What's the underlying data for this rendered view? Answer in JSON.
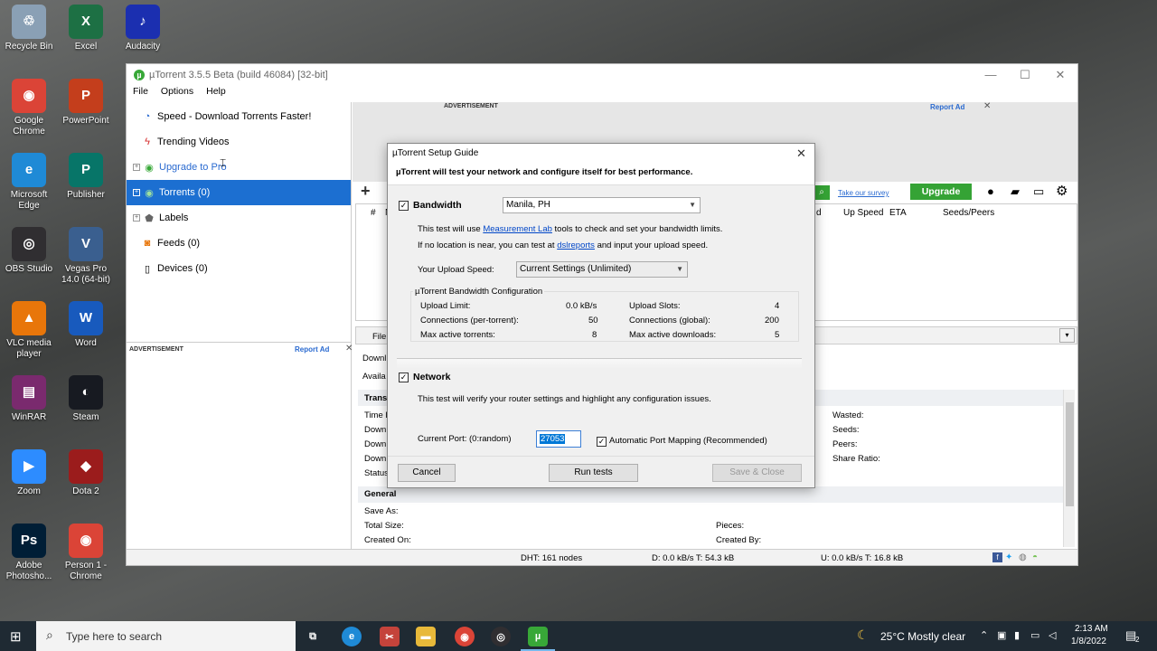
{
  "desktop": {
    "icons": [
      {
        "label": "Recycle Bin",
        "color": "#8aa0b5",
        "glyph": "♲"
      },
      {
        "label": "Excel",
        "color": "#1d7044",
        "glyph": "X"
      },
      {
        "label": "Audacity",
        "color": "#1b2fb0",
        "glyph": "♪"
      },
      {
        "label": "Google Chrome",
        "color": "#db4437",
        "glyph": "◉"
      },
      {
        "label": "PowerPoint",
        "color": "#c43e1c",
        "glyph": "P"
      },
      {
        "label": "Microsoft Edge",
        "color": "#1f8ad6",
        "glyph": "e"
      },
      {
        "label": "Publisher",
        "color": "#077568",
        "glyph": "P"
      },
      {
        "label": "OBS Studio",
        "color": "#302e31",
        "glyph": "◎"
      },
      {
        "label": "Vegas Pro 14.0 (64-bit)",
        "color": "#3a5f8f",
        "glyph": "V"
      },
      {
        "label": "VLC media player",
        "color": "#e8760a",
        "glyph": "▲"
      },
      {
        "label": "Word",
        "color": "#185abd",
        "glyph": "W"
      },
      {
        "label": "WinRAR",
        "color": "#7a2a6e",
        "glyph": "▤"
      },
      {
        "label": "Steam",
        "color": "#171a21",
        "glyph": "◐"
      },
      {
        "label": "Zoom",
        "color": "#2d8cff",
        "glyph": "▶"
      },
      {
        "label": "Dota 2",
        "color": "#9b1c1c",
        "glyph": "◆"
      },
      {
        "label": "Adobe Photosho...",
        "color": "#001e36",
        "glyph": "Ps"
      },
      {
        "label": "Person 1 - Chrome",
        "color": "#db4437",
        "glyph": "◉"
      }
    ]
  },
  "window": {
    "title": "µTorrent 3.5.5 Beta (build 46084) [32-bit]",
    "menu": [
      "File",
      "Options",
      "Help"
    ],
    "sidebar": {
      "items": [
        {
          "label": "Speed - Download Torrents Faster!",
          "icon": "speedometer-icon"
        },
        {
          "label": "Trending Videos",
          "icon": "lightning-icon"
        },
        {
          "label": "Upgrade to Pro",
          "icon": "utorrent-icon"
        },
        {
          "label": "Torrents (0)",
          "icon": "utorrent-icon"
        },
        {
          "label": "Labels",
          "icon": "label-icon"
        },
        {
          "label": "Feeds (0)",
          "icon": "rss-icon"
        },
        {
          "label": "Devices (0)",
          "icon": "device-icon"
        }
      ],
      "ad_label": "ADVERTISEMENT",
      "report_ad": "Report Ad"
    },
    "top_ad": {
      "label": "ADVERTISEMENT",
      "report_ad": "Report Ad"
    },
    "toolbar": {
      "survey": "Take our survey",
      "upgrade": "Upgrade"
    },
    "columns": [
      "#",
      "N",
      "d",
      "Up Speed",
      "ETA",
      "Seeds/Peers"
    ],
    "details": {
      "tab": "File",
      "rows_left": [
        "Downl",
        "Availa"
      ],
      "transfer": "Transf",
      "transfer_rows": [
        "Time E",
        "Down",
        "Down",
        "Down",
        "Status"
      ],
      "right_labels": [
        "Wasted:",
        "Seeds:",
        "Peers:",
        "Share Ratio:"
      ],
      "general": "General",
      "general_left": [
        "Save As:",
        "Total Size:",
        "Created On:"
      ],
      "general_right": [
        "Pieces:",
        "Created By:"
      ]
    },
    "status": {
      "dht": "DHT: 161 nodes",
      "down": "D: 0.0 kB/s T: 54.3 kB",
      "up": "U: 0.0 kB/s T: 16.8 kB"
    }
  },
  "dialog": {
    "title": "µTorrent Setup Guide",
    "subtitle": "µTorrent will test your network and configure itself for best performance.",
    "bandwidth": {
      "label": "Bandwidth",
      "location": "Manila, PH",
      "line1_pre": "This test will use ",
      "line1_link": "Measurement Lab",
      "line1_post": " tools to check and set your bandwidth limits.",
      "line2_pre": "If no location is near, you can test at ",
      "line2_link": "dslreports",
      "line2_post": " and input your upload speed.",
      "upload_label": "Your Upload Speed:",
      "upload_value": "Current Settings (Unlimited)",
      "config_title": "µTorrent Bandwidth Configuration",
      "config": [
        {
          "label": "Upload Limit:",
          "value": "0.0 kB/s",
          "label2": "Upload Slots:",
          "value2": "4"
        },
        {
          "label": "Connections (per-torrent):",
          "value": "50",
          "label2": "Connections (global):",
          "value2": "200"
        },
        {
          "label": "Max active torrents:",
          "value": "8",
          "label2": "Max active downloads:",
          "value2": "5"
        }
      ]
    },
    "network": {
      "label": "Network",
      "text": "This test will verify your router settings and highlight any configuration issues.",
      "port_label": "Current Port: (0:random)",
      "port_value": "27053",
      "mapping_label": "Automatic Port Mapping (Recommended)"
    },
    "buttons": {
      "cancel": "Cancel",
      "run": "Run tests",
      "save": "Save & Close"
    }
  },
  "taskbar": {
    "search_placeholder": "Type here to search",
    "weather": "25°C  Mostly clear",
    "time": "2:13 AM",
    "date": "1/8/2022",
    "notifications": "2"
  }
}
